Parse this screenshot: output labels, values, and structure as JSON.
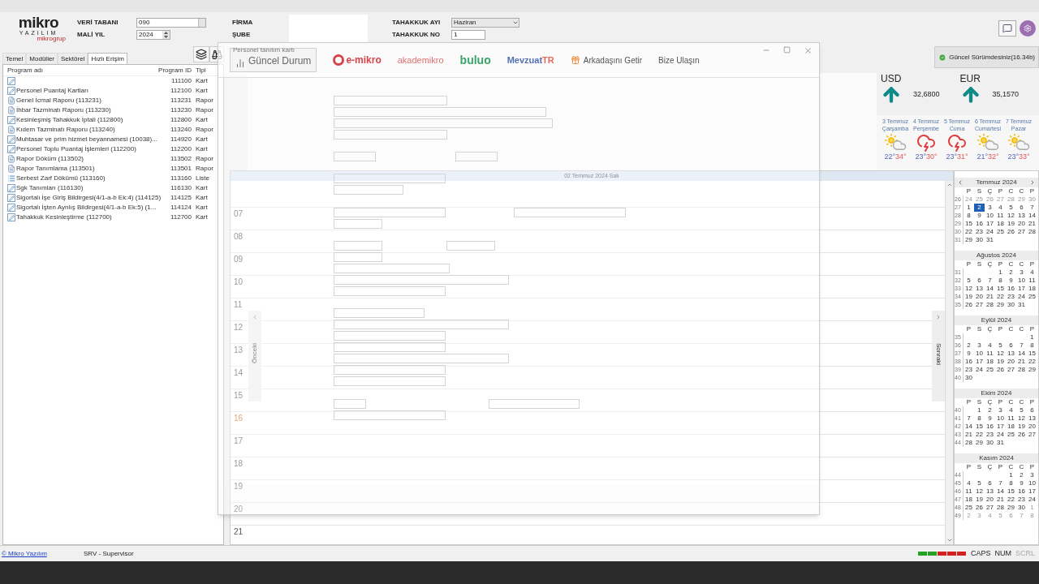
{
  "header": {
    "logo": {
      "word": "mikro",
      "sub": "YAZILIM",
      "group": "mikrogrup"
    },
    "fields": [
      {
        "label": "VERİ TABANI",
        "value": "090",
        "kind": "lookup"
      },
      {
        "label": "MALİ YIL",
        "value": "2024",
        "kind": "spin"
      }
    ],
    "company": [
      {
        "label": "FİRMA"
      },
      {
        "label": "ŞUBE"
      }
    ],
    "accrual": [
      {
        "label": "TAHAKKUK AYI",
        "value": "Haziran",
        "kind": "dropdown"
      },
      {
        "label": "TAHAKKUK NO",
        "value": "1",
        "kind": "text"
      }
    ]
  },
  "left_panel": {
    "tabs": [
      {
        "label": "Temel",
        "selected": false
      },
      {
        "label": "Modüller",
        "selected": false
      },
      {
        "label": "Sektörel",
        "selected": false
      },
      {
        "label": "Hızlı Erişim",
        "selected": true
      }
    ],
    "columns": [
      "Program adı",
      "Program ID",
      "Tipi"
    ],
    "rows": [
      {
        "kind": "card",
        "id": "111100",
        "type": "Kart"
      },
      {
        "kind": "card",
        "name": "Personel Puantaj Kartları",
        "id": "112100",
        "type": "Kart"
      },
      {
        "kind": "report",
        "name": "Genel İcmal Raporu (113231)",
        "id": "113231",
        "type": "Rapor"
      },
      {
        "kind": "report",
        "name": "İhbar Tazminatı Raporu (113230)",
        "id": "113230",
        "type": "Rapor"
      },
      {
        "kind": "card",
        "name": "Kesinleşmiş Tahakkuk İptali (112800)",
        "id": "112800",
        "type": "Kart"
      },
      {
        "kind": "report",
        "name": "Kıdem Tazminatı Raporu (113240)",
        "id": "113240",
        "type": "Rapor"
      },
      {
        "kind": "card",
        "name": "Muhtasar ve prim hizmet beyannamesi (10038)...",
        "id": "114920",
        "type": "Kart"
      },
      {
        "kind": "card",
        "name": "Personel Toplu Puantaj İşlemleri (112200)",
        "id": "112200",
        "type": "Kart"
      },
      {
        "kind": "report",
        "name": "Rapor Döküm (113502)",
        "id": "113502",
        "type": "Rapor"
      },
      {
        "kind": "report",
        "name": "Rapor Tanımlama (113501)",
        "id": "113501",
        "type": "Rapor"
      },
      {
        "kind": "list",
        "name": "Serbest Zarf Dökümü (113160)",
        "id": "113160",
        "type": "Liste"
      },
      {
        "kind": "card",
        "name": "Sgk Tanımları (116130)",
        "id": "116130",
        "type": "Kart"
      },
      {
        "kind": "card",
        "name": "Sigortalı İşe Giriş Bildirgesi(4/1-a-b Ek:4) (114125)",
        "id": "114125",
        "type": "Kart"
      },
      {
        "kind": "card",
        "name": "Sigortalı İşten Ayrılış Bildirgesi(4/1-a-b Ek:5) (1...",
        "id": "114124",
        "type": "Kart"
      },
      {
        "kind": "card",
        "name": "Tahakkuk Kesinleştirme (112700)",
        "id": "112700",
        "type": "Kart"
      }
    ]
  },
  "overlay": {
    "tooltip": "Personel tanıtım kartı",
    "toolbar": [
      {
        "kind": "status",
        "label": "Güncel Durum"
      },
      {
        "kind": "emikro",
        "label": "e-mikro"
      },
      {
        "kind": "akademi",
        "label": "akademikro"
      },
      {
        "kind": "buluo",
        "label": "buluo"
      },
      {
        "kind": "mevzuat",
        "label": "Mevzuat",
        "suffix": "TR"
      },
      {
        "kind": "gift",
        "label": "Arkadaşını Getir"
      },
      {
        "kind": "plain",
        "label": "Bize Ulaşın"
      }
    ]
  },
  "day_view": {
    "date": "02 Temmuz 2024 Salı",
    "hours": [
      {
        "label": "07",
        "current": false
      },
      {
        "label": "08",
        "current": false
      },
      {
        "label": "09",
        "current": false
      },
      {
        "label": "10",
        "current": false
      },
      {
        "label": "11",
        "current": false
      },
      {
        "label": "12",
        "current": false
      },
      {
        "label": "13",
        "current": false
      },
      {
        "label": "14",
        "current": false
      },
      {
        "label": "15",
        "current": false
      },
      {
        "label": "16",
        "current": true
      },
      {
        "label": "17",
        "current": false
      },
      {
        "label": "18",
        "current": false
      },
      {
        "label": "19",
        "current": false
      },
      {
        "label": "20",
        "current": false
      },
      {
        "label": "21",
        "current": false
      }
    ],
    "previous": "Önceki",
    "next": "Sonraki"
  },
  "version_button": "Güncel Sürümdesiniz(16.34b)",
  "currencies": [
    {
      "code": "USD",
      "rate": "32,6800"
    },
    {
      "code": "EUR",
      "rate": "35,1570"
    }
  ],
  "weather": [
    {
      "date": "3 Temmuz",
      "day": "Çarşamba",
      "kind": "sun",
      "low": "22°",
      "high": "34°"
    },
    {
      "date": "4 Temmuz",
      "day": "Perşembe",
      "kind": "storm",
      "low": "23°",
      "high": "30°"
    },
    {
      "date": "5 Temmuz",
      "day": "Cuma",
      "kind": "storm",
      "low": "23°",
      "high": "31°"
    },
    {
      "date": "6 Temmuz",
      "day": "Cumartesi",
      "kind": "sun",
      "low": "21°",
      "high": "32°"
    },
    {
      "date": "7 Temmuz",
      "day": "Pazar",
      "kind": "sun",
      "low": "23°",
      "high": "33°"
    }
  ],
  "calendar": {
    "months": [
      {
        "title": "Temmuz 2024",
        "nav": true,
        "weekdays": [
          "P",
          "S",
          "Ç",
          "P",
          "C",
          "C",
          "P"
        ],
        "weeks": [
          {
            "number": "26",
            "kind": "full",
            "days": [
              {
                "day": "24",
                "muted": true,
                "selected": false
              },
              {
                "day": "25",
                "muted": true,
                "selected": false
              },
              {
                "day": "26",
                "muted": true,
                "selected": false
              },
              {
                "day": "27",
                "muted": true,
                "selected": false
              },
              {
                "day": "28",
                "muted": true,
                "selected": false
              },
              {
                "day": "29",
                "muted": true,
                "selected": false
              },
              {
                "day": "30",
                "muted": true,
                "selected": false
              }
            ]
          },
          {
            "number": "27",
            "kind": "full",
            "days": [
              {
                "day": "1",
                "muted": false,
                "selected": false
              },
              {
                "day": "2",
                "muted": false,
                "selected": true
              },
              {
                "day": "3",
                "muted": false,
                "selected": false
              },
              {
                "day": "4",
                "muted": false,
                "selected": false
              },
              {
                "day": "5",
                "muted": false,
                "selected": false
              },
              {
                "day": "6",
                "muted": false,
                "selected": false
              },
              {
                "day": "7",
                "muted": false,
                "selected": false
              }
            ]
          },
          {
            "number": "28",
            "kind": "full",
            "days": [
              {
                "day": "8",
                "muted": false,
                "selected": false
              },
              {
                "day": "9",
                "muted": false,
                "selected": false
              },
              {
                "day": "10",
                "muted": false,
                "selected": false
              },
              {
                "day": "11",
                "muted": false,
                "selected": false
              },
              {
                "day": "12",
                "muted": false,
                "selected": false
              },
              {
                "day": "13",
                "muted": false,
                "selected": false
              },
              {
                "day": "14",
                "muted": false,
                "selected": false
              }
            ]
          },
          {
            "number": "29",
            "kind": "full",
            "days": [
              {
                "day": "15",
                "muted": false,
                "selected": false
              },
              {
                "day": "16",
                "muted": false,
                "selected": false
              },
              {
                "day": "17",
                "muted": false,
                "selected": false
              },
              {
                "day": "18",
                "muted": false,
                "selected": false
              },
              {
                "day": "19",
                "muted": false,
                "selected": false
              },
              {
                "day": "20",
                "muted": false,
                "selected": false
              },
              {
                "day": "21",
                "muted": false,
                "selected": false
              }
            ]
          },
          {
            "number": "30",
            "kind": "full",
            "days": [
              {
                "day": "22",
                "muted": false,
                "selected": false
              },
              {
                "day": "23",
                "muted": false,
                "selected": false
              },
              {
                "day": "24",
                "muted": false,
                "selected": false
              },
              {
                "day": "25",
                "muted": false,
                "selected": false
              },
              {
                "day": "26",
                "muted": false,
                "selected": false
              },
              {
                "day": "27",
                "muted": false,
                "selected": false
              },
              {
                "day": "28",
                "muted": false,
                "selected": false
              }
            ]
          },
          {
            "number": "31",
            "kind": "full",
            "days": [
              {
                "day": "29",
                "muted": false,
                "selected": false
              },
              {
                "day": "30",
                "muted": false,
                "selected": false
              },
              {
                "day": "31",
                "muted": false,
                "selected": false
              }
            ]
          }
        ]
      },
      {
        "title": "Ağustos 2024",
        "nav": false,
        "weekdays": [
          "P",
          "S",
          "Ç",
          "P",
          "C",
          "C",
          "P"
        ],
        "weeks": [
          {
            "number": "31",
            "kind": "first",
            "days": [
              {
                "day": "1",
                "muted": false,
                "selected": false
              },
              {
                "day": "2",
                "muted": false,
                "selected": false
              },
              {
                "day": "3",
                "muted": false,
                "selected": false
              },
              {
                "day": "4",
                "muted": false,
                "selected": false
              }
            ]
          },
          {
            "number": "32",
            "kind": "full",
            "days": [
              {
                "day": "5",
                "muted": false,
                "selected": false
              },
              {
                "day": "6",
                "muted": false,
                "selected": false
              },
              {
                "day": "7",
                "muted": false,
                "selected": false
              },
              {
                "day": "8",
                "muted": false,
                "selected": false
              },
              {
                "day": "9",
                "muted": false,
                "selected": false
              },
              {
                "day": "10",
                "muted": false,
                "selected": false
              },
              {
                "day": "11",
                "muted": false,
                "selected": false
              }
            ]
          },
          {
            "number": "33",
            "kind": "full",
            "days": [
              {
                "day": "12",
                "muted": false,
                "selected": false
              },
              {
                "day": "13",
                "muted": false,
                "selected": false
              },
              {
                "day": "14",
                "muted": false,
                "selected": false
              },
              {
                "day": "15",
                "muted": false,
                "selected": false
              },
              {
                "day": "16",
                "muted": false,
                "selected": false
              },
              {
                "day": "17",
                "muted": false,
                "selected": false
              },
              {
                "day": "18",
                "muted": false,
                "selected": false
              }
            ]
          },
          {
            "number": "34",
            "kind": "full",
            "days": [
              {
                "day": "19",
                "muted": false,
                "selected": false
              },
              {
                "day": "20",
                "muted": false,
                "selected": false
              },
              {
                "day": "21",
                "muted": false,
                "selected": false
              },
              {
                "day": "22",
                "muted": false,
                "selected": false
              },
              {
                "day": "23",
                "muted": false,
                "selected": false
              },
              {
                "day": "24",
                "muted": false,
                "selected": false
              },
              {
                "day": "25",
                "muted": false,
                "selected": false
              }
            ]
          },
          {
            "number": "35",
            "kind": "full",
            "days": [
              {
                "day": "26",
                "muted": false,
                "selected": false
              },
              {
                "day": "27",
                "muted": false,
                "selected": false
              },
              {
                "day": "28",
                "muted": false,
                "selected": false
              },
              {
                "day": "29",
                "muted": false,
                "selected": false
              },
              {
                "day": "30",
                "muted": false,
                "selected": false
              },
              {
                "day": "31",
                "muted": false,
                "selected": false
              }
            ]
          }
        ]
      },
      {
        "title": "Eylül 2024",
        "nav": false,
        "weekdays": [
          "P",
          "S",
          "Ç",
          "P",
          "C",
          "C",
          "P"
        ],
        "weeks": [
          {
            "number": "35",
            "kind": "first",
            "days": [
              {
                "day": "1",
                "muted": false,
                "selected": false
              }
            ]
          },
          {
            "number": "36",
            "kind": "full",
            "days": [
              {
                "day": "2",
                "muted": false,
                "selected": false
              },
              {
                "day": "3",
                "muted": false,
                "selected": false
              },
              {
                "day": "4",
                "muted": false,
                "selected": false
              },
              {
                "day": "5",
                "muted": false,
                "selected": false
              },
              {
                "day": "6",
                "muted": false,
                "selected": false
              },
              {
                "day": "7",
                "muted": false,
                "selected": false
              },
              {
                "day": "8",
                "muted": false,
                "selected": false
              }
            ]
          },
          {
            "number": "37",
            "kind": "full",
            "days": [
              {
                "day": "9",
                "muted": false,
                "selected": false
              },
              {
                "day": "10",
                "muted": false,
                "selected": false
              },
              {
                "day": "11",
                "muted": false,
                "selected": false
              },
              {
                "day": "12",
                "muted": false,
                "selected": false
              },
              {
                "day": "13",
                "muted": false,
                "selected": false
              },
              {
                "day": "14",
                "muted": false,
                "selected": false
              },
              {
                "day": "15",
                "muted": false,
                "selected": false
              }
            ]
          },
          {
            "number": "38",
            "kind": "full",
            "days": [
              {
                "day": "16",
                "muted": false,
                "selected": false
              },
              {
                "day": "17",
                "muted": false,
                "selected": false
              },
              {
                "day": "18",
                "muted": false,
                "selected": false
              },
              {
                "day": "19",
                "muted": false,
                "selected": false
              },
              {
                "day": "20",
                "muted": false,
                "selected": false
              },
              {
                "day": "21",
                "muted": false,
                "selected": false
              },
              {
                "day": "22",
                "muted": false,
                "selected": false
              }
            ]
          },
          {
            "number": "39",
            "kind": "full",
            "days": [
              {
                "day": "23",
                "muted": false,
                "selected": false
              },
              {
                "day": "24",
                "muted": false,
                "selected": false
              },
              {
                "day": "25",
                "muted": false,
                "selected": false
              },
              {
                "day": "26",
                "muted": false,
                "selected": false
              },
              {
                "day": "27",
                "muted": false,
                "selected": false
              },
              {
                "day": "28",
                "muted": false,
                "selected": false
              },
              {
                "day": "29",
                "muted": false,
                "selected": false
              }
            ]
          },
          {
            "number": "40",
            "kind": "full",
            "days": [
              {
                "day": "30",
                "muted": false,
                "selected": false
              }
            ]
          }
        ]
      },
      {
        "title": "Ekim 2024",
        "nav": false,
        "weekdays": [
          "P",
          "S",
          "Ç",
          "P",
          "C",
          "C",
          "P"
        ],
        "weeks": [
          {
            "number": "40",
            "kind": "first",
            "days": [
              {
                "day": "1",
                "muted": false,
                "selected": false
              },
              {
                "day": "2",
                "muted": false,
                "selected": false
              },
              {
                "day": "3",
                "muted": false,
                "selected": false
              },
              {
                "day": "4",
                "muted": false,
                "selected": false
              },
              {
                "day": "5",
                "muted": false,
                "selected": false
              },
              {
                "day": "6",
                "muted": false,
                "selected": false
              }
            ]
          },
          {
            "number": "41",
            "kind": "full",
            "days": [
              {
                "day": "7",
                "muted": false,
                "selected": false
              },
              {
                "day": "8",
                "muted": false,
                "selected": false
              },
              {
                "day": "9",
                "muted": false,
                "selected": false
              },
              {
                "day": "10",
                "muted": false,
                "selected": false
              },
              {
                "day": "11",
                "muted": false,
                "selected": false
              },
              {
                "day": "12",
                "muted": false,
                "selected": false
              },
              {
                "day": "13",
                "muted": false,
                "selected": false
              }
            ]
          },
          {
            "number": "42",
            "kind": "full",
            "days": [
              {
                "day": "14",
                "muted": false,
                "selected": false
              },
              {
                "day": "15",
                "muted": false,
                "selected": false
              },
              {
                "day": "16",
                "muted": false,
                "selected": false
              },
              {
                "day": "17",
                "muted": false,
                "selected": false
              },
              {
                "day": "18",
                "muted": false,
                "selected": false
              },
              {
                "day": "19",
                "muted": false,
                "selected": false
              },
              {
                "day": "20",
                "muted": false,
                "selected": false
              }
            ]
          },
          {
            "number": "43",
            "kind": "full",
            "days": [
              {
                "day": "21",
                "muted": false,
                "selected": false
              },
              {
                "day": "22",
                "muted": false,
                "selected": false
              },
              {
                "day": "23",
                "muted": false,
                "selected": false
              },
              {
                "day": "24",
                "muted": false,
                "selected": false
              },
              {
                "day": "25",
                "muted": false,
                "selected": false
              },
              {
                "day": "26",
                "muted": false,
                "selected": false
              },
              {
                "day": "27",
                "muted": false,
                "selected": false
              }
            ]
          },
          {
            "number": "44",
            "kind": "full",
            "days": [
              {
                "day": "28",
                "muted": false,
                "selected": false
              },
              {
                "day": "29",
                "muted": false,
                "selected": false
              },
              {
                "day": "30",
                "muted": false,
                "selected": false
              },
              {
                "day": "31",
                "muted": false,
                "selected": false
              }
            ]
          }
        ]
      },
      {
        "title": "Kasım 2024",
        "nav": false,
        "weekdays": [
          "P",
          "S",
          "Ç",
          "P",
          "C",
          "C",
          "P"
        ],
        "weeks": [
          {
            "number": "44",
            "kind": "first",
            "days": [
              {
                "day": "1",
                "muted": false,
                "selected": false
              },
              {
                "day": "2",
                "muted": false,
                "selected": false
              },
              {
                "day": "3",
                "muted": false,
                "selected": false
              }
            ]
          },
          {
            "number": "45",
            "kind": "full",
            "days": [
              {
                "day": "4",
                "muted": false,
                "selected": false
              },
              {
                "day": "5",
                "muted": false,
                "selected": false
              },
              {
                "day": "6",
                "muted": false,
                "selected": false
              },
              {
                "day": "7",
                "muted": false,
                "selected": false
              },
              {
                "day": "8",
                "muted": false,
                "selected": false
              },
              {
                "day": "9",
                "muted": false,
                "selected": false
              },
              {
                "day": "10",
                "muted": false,
                "selected": false
              }
            ]
          },
          {
            "number": "46",
            "kind": "full",
            "days": [
              {
                "day": "11",
                "muted": false,
                "selected": false
              },
              {
                "day": "12",
                "muted": false,
                "selected": false
              },
              {
                "day": "13",
                "muted": false,
                "selected": false
              },
              {
                "day": "14",
                "muted": false,
                "selected": false
              },
              {
                "day": "15",
                "muted": false,
                "selected": false
              },
              {
                "day": "16",
                "muted": false,
                "selected": false
              },
              {
                "day": "17",
                "muted": false,
                "selected": false
              }
            ]
          },
          {
            "number": "47",
            "kind": "full",
            "days": [
              {
                "day": "18",
                "muted": false,
                "selected": false
              },
              {
                "day": "19",
                "muted": false,
                "selected": false
              },
              {
                "day": "20",
                "muted": false,
                "selected": false
              },
              {
                "day": "21",
                "muted": false,
                "selected": false
              },
              {
                "day": "22",
                "muted": false,
                "selected": false
              },
              {
                "day": "23",
                "muted": false,
                "selected": false
              },
              {
                "day": "24",
                "muted": false,
                "selected": false
              }
            ]
          },
          {
            "number": "48",
            "kind": "full",
            "days": [
              {
                "day": "25",
                "muted": false,
                "selected": false
              },
              {
                "day": "26",
                "muted": false,
                "selected": false
              },
              {
                "day": "27",
                "muted": false,
                "selected": false
              },
              {
                "day": "28",
                "muted": false,
                "selected": false
              },
              {
                "day": "29",
                "muted": false,
                "selected": false
              },
              {
                "day": "30",
                "muted": false,
                "selected": false
              },
              {
                "day": "1",
                "muted": true,
                "selected": false
              }
            ]
          },
          {
            "number": "49",
            "kind": "full",
            "days": [
              {
                "day": "2",
                "muted": true,
                "selected": false
              },
              {
                "day": "3",
                "muted": true,
                "selected": false
              },
              {
                "day": "4",
                "muted": true,
                "selected": false
              },
              {
                "day": "5",
                "muted": true,
                "selected": false
              },
              {
                "day": "6",
                "muted": true,
                "selected": false
              },
              {
                "day": "7",
                "muted": true,
                "selected": false
              },
              {
                "day": "8",
                "muted": true,
                "selected": false
              }
            ]
          }
        ]
      }
    ]
  },
  "status_bar": {
    "link": "© Mikro Yazılım",
    "user": "SRV - Supervisor",
    "lights": [
      {
        "color": "#22a322"
      },
      {
        "color": "#22a322"
      },
      {
        "color": "#d42020"
      },
      {
        "color": "#d42020"
      },
      {
        "color": "#d42020"
      }
    ],
    "keys": [
      {
        "label": "CAPS",
        "on": true
      },
      {
        "label": "NUM",
        "on": true
      },
      {
        "label": "SCRL",
        "on": false
      }
    ]
  }
}
